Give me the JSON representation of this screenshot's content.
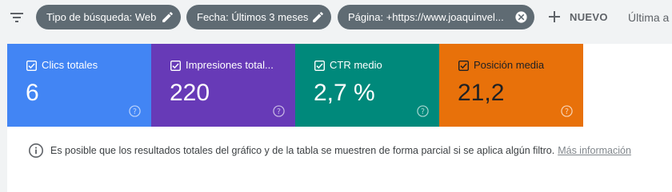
{
  "filters": {
    "chips": [
      {
        "label": "Tipo de búsqueda: Web",
        "icon": "edit-icon"
      },
      {
        "label": "Fecha: Últimos 3 meses",
        "icon": "edit-icon"
      },
      {
        "label": "Página: +https://www.joaquinvel...",
        "icon": "close-circle-icon"
      }
    ],
    "new_label": "NUEVO",
    "last_update_label": "Última a"
  },
  "metrics": [
    {
      "label": "Clics totales",
      "value": "6",
      "color": "#4285f4"
    },
    {
      "label": "Impresiones total...",
      "value": "220",
      "color": "#673ab7"
    },
    {
      "label": "CTR medio",
      "value": "2,7 %",
      "color": "#00897b"
    },
    {
      "label": "Posición media",
      "value": "21,2",
      "color": "#e8710a"
    }
  ],
  "info": {
    "text": "Es posible que los resultados totales del gráfico y de la tabla se muestren de forma parcial si se aplica algún filtro.",
    "link": "Más información"
  }
}
